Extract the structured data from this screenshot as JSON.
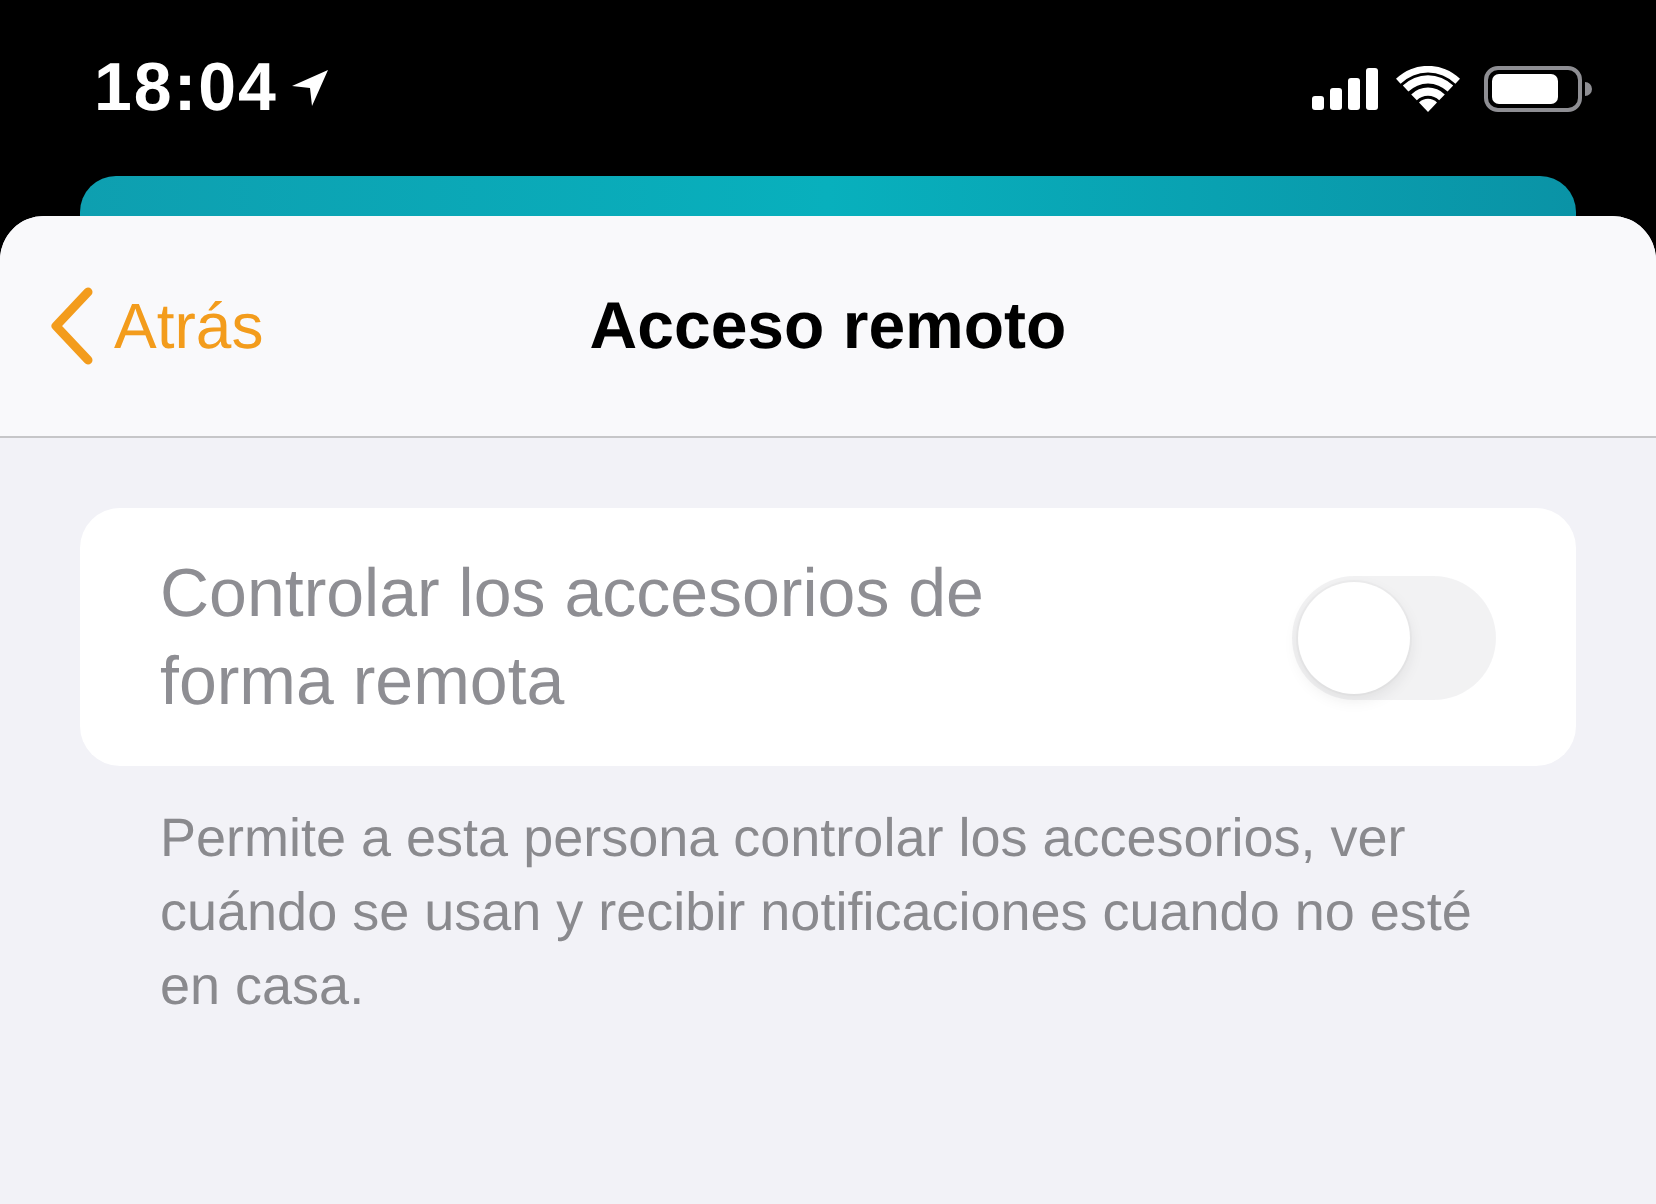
{
  "status_bar": {
    "time": "18:04"
  },
  "nav": {
    "back": "Atrás",
    "title": "Acceso remoto"
  },
  "settings": [
    {
      "kind": "toggle",
      "label": "Controlar los accesorios de forma remota",
      "on": false,
      "disabled": true
    }
  ],
  "footer": "Permite a esta persona controlar los accesorios, ver cuándo se usan y recibir notificaciones cuando no esté en casa."
}
